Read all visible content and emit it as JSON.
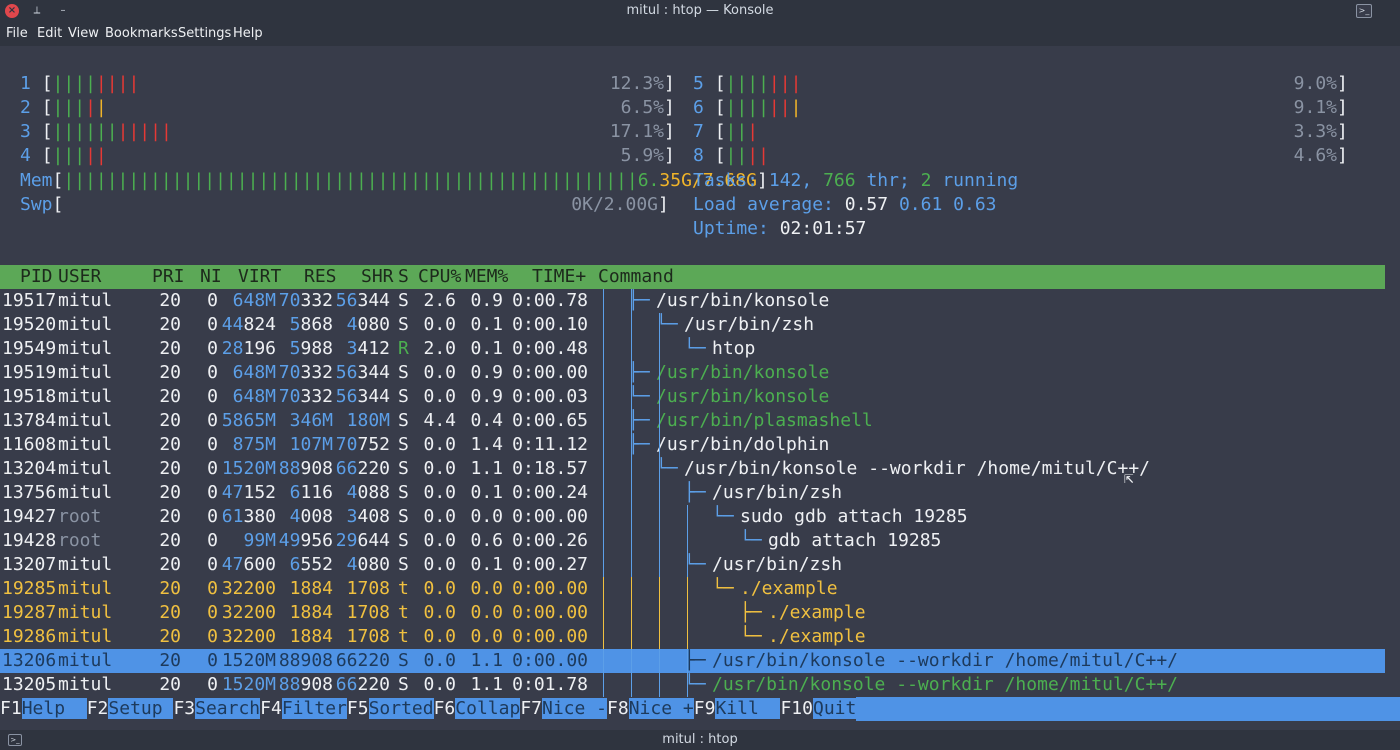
{
  "window": {
    "title": "mitul : htop — Konsole",
    "tab_title": "mitul : htop"
  },
  "menu": [
    "File",
    "Edit",
    "View",
    "Bookmarks",
    "Settings",
    "Help"
  ],
  "cpus": [
    {
      "id": "1",
      "bars": "||||||||",
      "percent": "12.3%"
    },
    {
      "id": "2",
      "bars": "|||||",
      "percent": "6.5%"
    },
    {
      "id": "3",
      "bars": "|||||||||||",
      "percent": "17.1%"
    },
    {
      "id": "4",
      "bars": "|||||",
      "percent": "5.9%"
    },
    {
      "id": "5",
      "bars": "|||||||",
      "percent": "9.0%"
    },
    {
      "id": "6",
      "bars": "|||||||",
      "percent": "9.1%"
    },
    {
      "id": "7",
      "bars": "|||",
      "percent": "3.3%"
    },
    {
      "id": "8",
      "bars": "||||",
      "percent": "4.6%"
    }
  ],
  "mem": {
    "label": "Mem",
    "bars": "|||||||||||||||||||||||||||||||||||||||||||||||||||||",
    "value": "6.35G/7.68G"
  },
  "swp": {
    "label": "Swp",
    "value": "0K/2.00G"
  },
  "tasks": {
    "label": "Tasks:",
    "count": "142,",
    "threads": "766",
    "thr_label": "thr;",
    "running": "2",
    "running_label": "running"
  },
  "load": {
    "label": "Load average:",
    "l1": "0.57",
    "l5": "0.61",
    "l15": "0.63"
  },
  "uptime": {
    "label": "Uptime:",
    "value": "02:01:57"
  },
  "columns": [
    "PID",
    "USER",
    "PRI",
    "NI",
    "VIRT",
    "RES",
    "SHR",
    "S",
    "CPU%",
    "MEM%",
    "TIME+",
    "Command"
  ],
  "processes": [
    {
      "pid": "19517",
      "user": "mitul",
      "pri": "20",
      "ni": "0",
      "virt": "648M",
      "res": "70332",
      "shr": "56344",
      "s": "S",
      "cpu": "2.6",
      "mem": "0.9",
      "time": "0:00.78",
      "tree": "├─",
      "cmd": "/usr/bin/konsole",
      "state": "normal"
    },
    {
      "pid": "19520",
      "user": "mitul",
      "pri": "20",
      "ni": "0",
      "virt": "44824",
      "res": "5868",
      "shr": "4080",
      "s": "S",
      "cpu": "0.0",
      "mem": "0.1",
      "time": "0:00.10",
      "tree": "└─",
      "cmd": "/usr/bin/zsh",
      "state": "normal"
    },
    {
      "pid": "19549",
      "user": "mitul",
      "pri": "20",
      "ni": "0",
      "virt": "28196",
      "res": "5988",
      "shr": "3412",
      "s": "R",
      "cpu": "2.0",
      "mem": "0.1",
      "time": "0:00.48",
      "tree": "└─",
      "cmd": "htop",
      "state": "normal"
    },
    {
      "pid": "19519",
      "user": "mitul",
      "pri": "20",
      "ni": "0",
      "virt": "648M",
      "res": "70332",
      "shr": "56344",
      "s": "S",
      "cpu": "0.0",
      "mem": "0.9",
      "time": "0:00.00",
      "tree": "├─",
      "cmd": "/usr/bin/konsole",
      "state": "thread"
    },
    {
      "pid": "19518",
      "user": "mitul",
      "pri": "20",
      "ni": "0",
      "virt": "648M",
      "res": "70332",
      "shr": "56344",
      "s": "S",
      "cpu": "0.0",
      "mem": "0.9",
      "time": "0:00.03",
      "tree": "└─",
      "cmd": "/usr/bin/konsole",
      "state": "thread"
    },
    {
      "pid": "13784",
      "user": "mitul",
      "pri": "20",
      "ni": "0",
      "virt": "5865M",
      "res": "346M",
      "shr": "180M",
      "s": "S",
      "cpu": "4.4",
      "mem": "0.4",
      "time": "0:00.65",
      "tree": "├─",
      "cmd": "/usr/bin/plasmashell",
      "state": "thread"
    },
    {
      "pid": "11608",
      "user": "mitul",
      "pri": "20",
      "ni": "0",
      "virt": "875M",
      "res": "107M",
      "shr": "70752",
      "s": "S",
      "cpu": "0.0",
      "mem": "1.4",
      "time": "0:11.12",
      "tree": "├─",
      "cmd": "/usr/bin/dolphin",
      "state": "normal"
    },
    {
      "pid": "13204",
      "user": "mitul",
      "pri": "20",
      "ni": "0",
      "virt": "1520M",
      "res": "88908",
      "shr": "66220",
      "s": "S",
      "cpu": "0.0",
      "mem": "1.1",
      "time": "0:18.57",
      "tree": "└─",
      "cmd": "/usr/bin/konsole --workdir /home/mitul/C++/",
      "state": "normal"
    },
    {
      "pid": "13756",
      "user": "mitul",
      "pri": "20",
      "ni": "0",
      "virt": "47152",
      "res": "6116",
      "shr": "4088",
      "s": "S",
      "cpu": "0.0",
      "mem": "0.1",
      "time": "0:00.24",
      "tree": "├─",
      "cmd": "/usr/bin/zsh",
      "state": "normal"
    },
    {
      "pid": "19427",
      "user": "root",
      "pri": "20",
      "ni": "0",
      "virt": "61380",
      "res": "4008",
      "shr": "3408",
      "s": "S",
      "cpu": "0.0",
      "mem": "0.0",
      "time": "0:00.00",
      "tree": "└─",
      "cmd": "sudo gdb attach 19285",
      "state": "normal"
    },
    {
      "pid": "19428",
      "user": "root",
      "pri": "20",
      "ni": "0",
      "virt": "99M",
      "res": "49956",
      "shr": "29644",
      "s": "S",
      "cpu": "0.0",
      "mem": "0.6",
      "time": "0:00.26",
      "tree": "└─",
      "cmd": "gdb attach 19285",
      "state": "normal"
    },
    {
      "pid": "13207",
      "user": "mitul",
      "pri": "20",
      "ni": "0",
      "virt": "47600",
      "res": "6552",
      "shr": "4080",
      "s": "S",
      "cpu": "0.0",
      "mem": "0.1",
      "time": "0:00.27",
      "tree": "└─",
      "cmd": "/usr/bin/zsh",
      "state": "normal"
    },
    {
      "pid": "19285",
      "user": "mitul",
      "pri": "20",
      "ni": "0",
      "virt": "32200",
      "res": "1884",
      "shr": "1708",
      "s": "t",
      "cpu": "0.0",
      "mem": "0.0",
      "time": "0:00.00",
      "tree": "└─",
      "cmd": "./example",
      "state": "stopped"
    },
    {
      "pid": "19287",
      "user": "mitul",
      "pri": "20",
      "ni": "0",
      "virt": "32200",
      "res": "1884",
      "shr": "1708",
      "s": "t",
      "cpu": "0.0",
      "mem": "0.0",
      "time": "0:00.00",
      "tree": "├─",
      "cmd": "./example",
      "state": "stopped"
    },
    {
      "pid": "19286",
      "user": "mitul",
      "pri": "20",
      "ni": "0",
      "virt": "32200",
      "res": "1884",
      "shr": "1708",
      "s": "t",
      "cpu": "0.0",
      "mem": "0.0",
      "time": "0:00.00",
      "tree": "└─",
      "cmd": "./example",
      "state": "stopped"
    },
    {
      "pid": "13206",
      "user": "mitul",
      "pri": "20",
      "ni": "0",
      "virt": "1520M",
      "res": "88908",
      "shr": "66220",
      "s": "S",
      "cpu": "0.0",
      "mem": "1.1",
      "time": "0:00.00",
      "tree": "├─",
      "cmd": "/usr/bin/konsole --workdir /home/mitul/C++/",
      "state": "selected"
    },
    {
      "pid": "13205",
      "user": "mitul",
      "pri": "20",
      "ni": "0",
      "virt": "1520M",
      "res": "88908",
      "shr": "66220",
      "s": "S",
      "cpu": "0.0",
      "mem": "1.1",
      "time": "0:01.78",
      "tree": "└─",
      "cmd": "/usr/bin/konsole --workdir /home/mitul/C++/",
      "state": "thread"
    }
  ],
  "fkeys": [
    {
      "key": "F1",
      "label": "Help  "
    },
    {
      "key": "F2",
      "label": "Setup "
    },
    {
      "key": "F3",
      "label": "Search"
    },
    {
      "key": "F4",
      "label": "Filter"
    },
    {
      "key": "F5",
      "label": "Sorted"
    },
    {
      "key": "F6",
      "label": "Collap"
    },
    {
      "key": "F7",
      "label": "Nice -"
    },
    {
      "key": "F8",
      "label": "Nice +"
    },
    {
      "key": "F9",
      "label": "Kill  "
    },
    {
      "key": "F10",
      "label": "Quit"
    }
  ],
  "colors": {
    "accent": "#5c9fe8",
    "header_bg": "#5ca857",
    "selected_bg": "#4f93e6",
    "stopped": "#f0c040",
    "thread": "#4caf50",
    "terminal_bg": "#383c4a"
  }
}
